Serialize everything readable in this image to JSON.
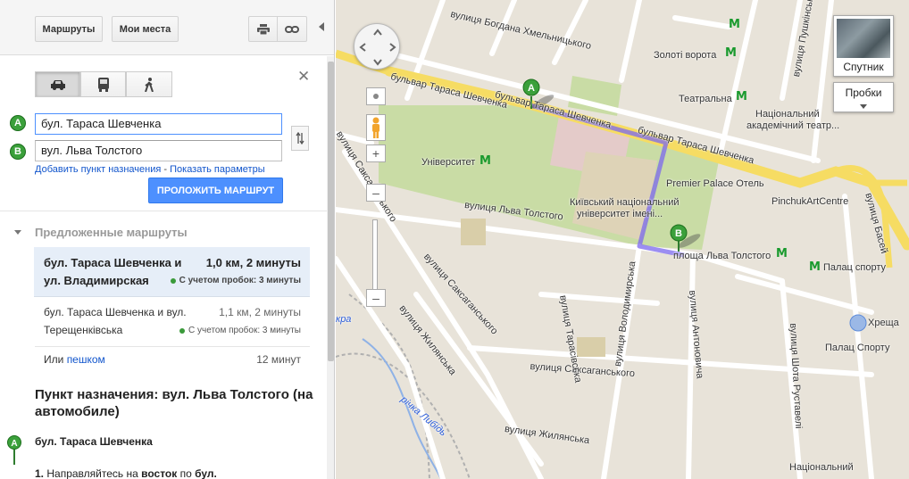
{
  "header": {
    "routes_label": "Маршруты",
    "places_label": "Мои места",
    "print_icon": "printer-icon",
    "link_icon": "link-icon"
  },
  "travel_modes": [
    "car-icon",
    "bus-icon",
    "walk-icon"
  ],
  "inputs": {
    "marker_a": "A",
    "marker_b": "B",
    "from_value": "бул. Тараса Шевченка",
    "to_value": "вул. Льва Толстого"
  },
  "links": {
    "add_destination": "Добавить пункт назначения",
    "separator": " - ",
    "show_options": "Показать параметры"
  },
  "route_button": "ПРОЛОЖИТЬ МАРШРУТ",
  "suggested": {
    "title": "Предложенные маршруты",
    "routes": [
      {
        "line1": "бул. Тараса Шевченка и",
        "line2": "ул. Владимирская",
        "distance": "1,0 км, 2 минуты",
        "traffic": "С учетом пробок: 3 минуты"
      },
      {
        "line1": "бул. Тараса Шевченка и вул.",
        "line2": "Терещенківська",
        "distance": "1,1 км, 2 минуты",
        "traffic": "С учетом пробок: 3 минуты"
      }
    ],
    "walk_prefix": "Или",
    "walk_link": "пешком",
    "walk_time": "12 минут"
  },
  "directions": {
    "title": "Пункт назначения: вул. Льва Толстого (на автомобиле)",
    "start_marker": "A",
    "start": "бул. Тараса Шевченка",
    "step1_num": "1.",
    "step1_pre": "Направляйтесь на",
    "step1_dir": "восток",
    "step1_mid": "по",
    "step1_street": "бул."
  },
  "map": {
    "satellite_label": "Спутник",
    "traffic_label": "Пробки",
    "route_color": "#7b68ee",
    "labels": {
      "bohdana": "вулиця Богдана Хмельницького",
      "pushkinska": "вулиця Пушкінська",
      "zoloti_vorota": "Золоті ворота",
      "teatralna": "Театральна",
      "nat_theatre_1": "Національний",
      "nat_theatre_2": "академічний театр...",
      "shevchenka_1": "бульвар Тараса Шевченка",
      "shevchenka_2": "бульвар Тараса Шевченка",
      "shevchenka_3": "бульвар Тараса Шевченка",
      "universytet": "Університет",
      "premier": "Premier Palace Отель",
      "pinchuk": "PinchukArtCentre",
      "basei": "вулиця Басей",
      "knu_1": "Київський національний",
      "knu_2": "університет імені...",
      "lva_1": "вулиця Льва Толстого",
      "lva_2": "площа Льва Толстого",
      "palats_sportu": "Палац спорту",
      "khreshch": "Хреща",
      "saksaganskogo_1": "вулиця Саксаганського",
      "saksaganskogo_2": "вулиця Саксаганського",
      "saksaganskogo_3": "вулиця Саксаганського",
      "tarasivska": "вулиця Тарасівська",
      "volodymyrska": "вулиця Володимирська",
      "antonovycha": "вулиця Антоновича",
      "zhylianska_1": "вулиця Жилянська",
      "zhylianska_2": "вулиця Жилянська",
      "rustaveli": "вулиця Шота Руставелі",
      "palats_sportu_2": "Палац Спорту",
      "lybid": "річка Либідь",
      "kra": "кра",
      "nat_bottom": "Національний"
    },
    "metro_symbol": "M"
  }
}
